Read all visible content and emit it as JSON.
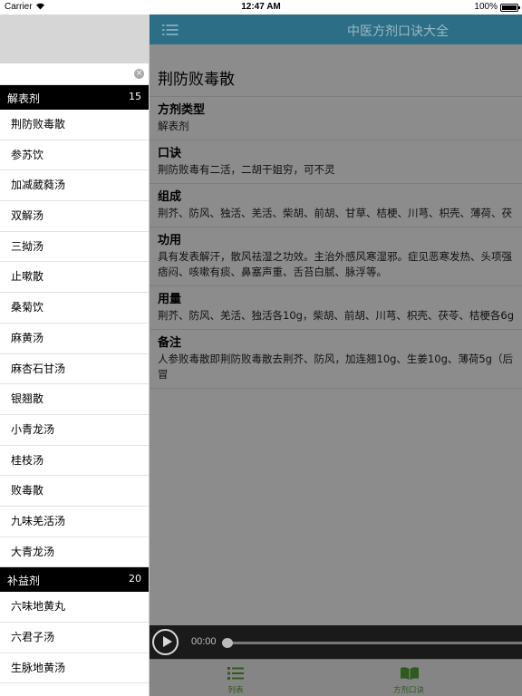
{
  "statusbar": {
    "carrier": "Carrier",
    "time": "12:47 AM",
    "battery": "100%"
  },
  "search": {
    "value": "",
    "placeholder": ""
  },
  "sections": [
    {
      "title": "解表剂",
      "count": "15",
      "items": [
        "荆防败毒散",
        "参苏饮",
        "加减葳蕤汤",
        "双解汤",
        "三拗汤",
        "止嗽散",
        "桑菊饮",
        "麻黄汤",
        "麻杏石甘汤",
        "银翘散",
        "小青龙汤",
        "桂枝汤",
        "败毒散",
        "九味羌活汤",
        "大青龙汤"
      ]
    },
    {
      "title": "补益剂",
      "count": "20",
      "items": [
        "六味地黄丸",
        "六君子汤",
        "生脉地黄汤"
      ]
    }
  ],
  "nav": {
    "title": "中医方剂口诀大全"
  },
  "detail": {
    "title": "荆防败毒散",
    "blocks": [
      {
        "label": "方剂类型",
        "lines": [
          "解表剂"
        ]
      },
      {
        "label": "口诀",
        "lines": [
          "荆防败毒有二活，二胡干姐穷，可不灵"
        ]
      },
      {
        "label": "组成",
        "lines": [
          "荆芥、防风、独活、羌活、柴胡、前胡、甘草、桔梗、川芎、枳壳、薄荷、茯"
        ]
      },
      {
        "label": "功用",
        "lines": [
          "具有发表解汗，散风祛湿之功效。主治外感风寒湿邪。症见恶寒发热、头项强",
          "痞闷、咳嗽有痰、鼻塞声重、舌苔白腻、脉浮等。"
        ]
      },
      {
        "label": "用量",
        "lines": [
          "荆芥、防风、羌活、独活各10g，柴胡、前胡、川芎、枳壳、茯苓、桔梗各6g"
        ]
      },
      {
        "label": "备注",
        "lines": [
          "人参败毒散即荆防败毒散去荆芥、防风，加连翘10g、生姜10g、薄荷5g（后",
          "冒"
        ]
      }
    ]
  },
  "player": {
    "time": "00:00",
    "progress": 0
  },
  "tabs": {
    "list_label": "列表",
    "book_label": "方剂口诀"
  },
  "colors": {
    "nav": "#2b6e86",
    "tab_active": "#2e5a1e",
    "overlay": "#8c8c8c"
  },
  "icons": {
    "nav_menu": "list-icon",
    "tab_list": "list-icon",
    "tab_book": "book-icon"
  }
}
